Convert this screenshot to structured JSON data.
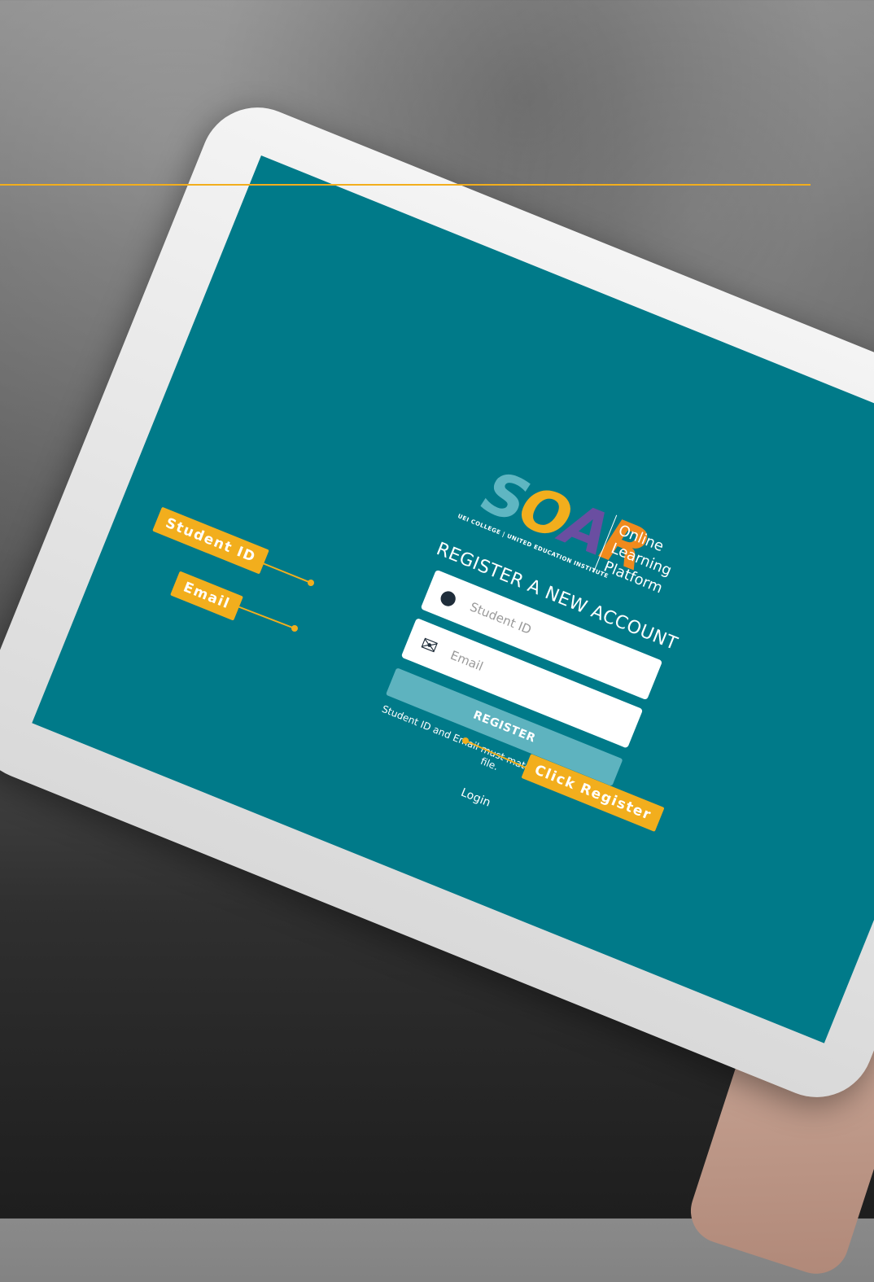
{
  "brand": {
    "logo_text": "SOAR",
    "logo_subtitle": "UEI COLLEGE | UNITED EDUCATION INSTITUTE",
    "tagline_lines": [
      "Online",
      "Learning",
      "Platform"
    ]
  },
  "form": {
    "title": "REGISTER A NEW ACCOUNT",
    "student_id_placeholder": "Student ID",
    "email_placeholder": "Email",
    "register_label": "REGISTER",
    "note": "Student ID and Email must match information on file.",
    "login_link": "Login"
  },
  "callouts": {
    "student_id": "Student ID",
    "email": "Email",
    "register": "Click Register"
  },
  "colors": {
    "accent": "#f2ae1d",
    "screen": "#007a89",
    "button": "#5eb3bf"
  }
}
